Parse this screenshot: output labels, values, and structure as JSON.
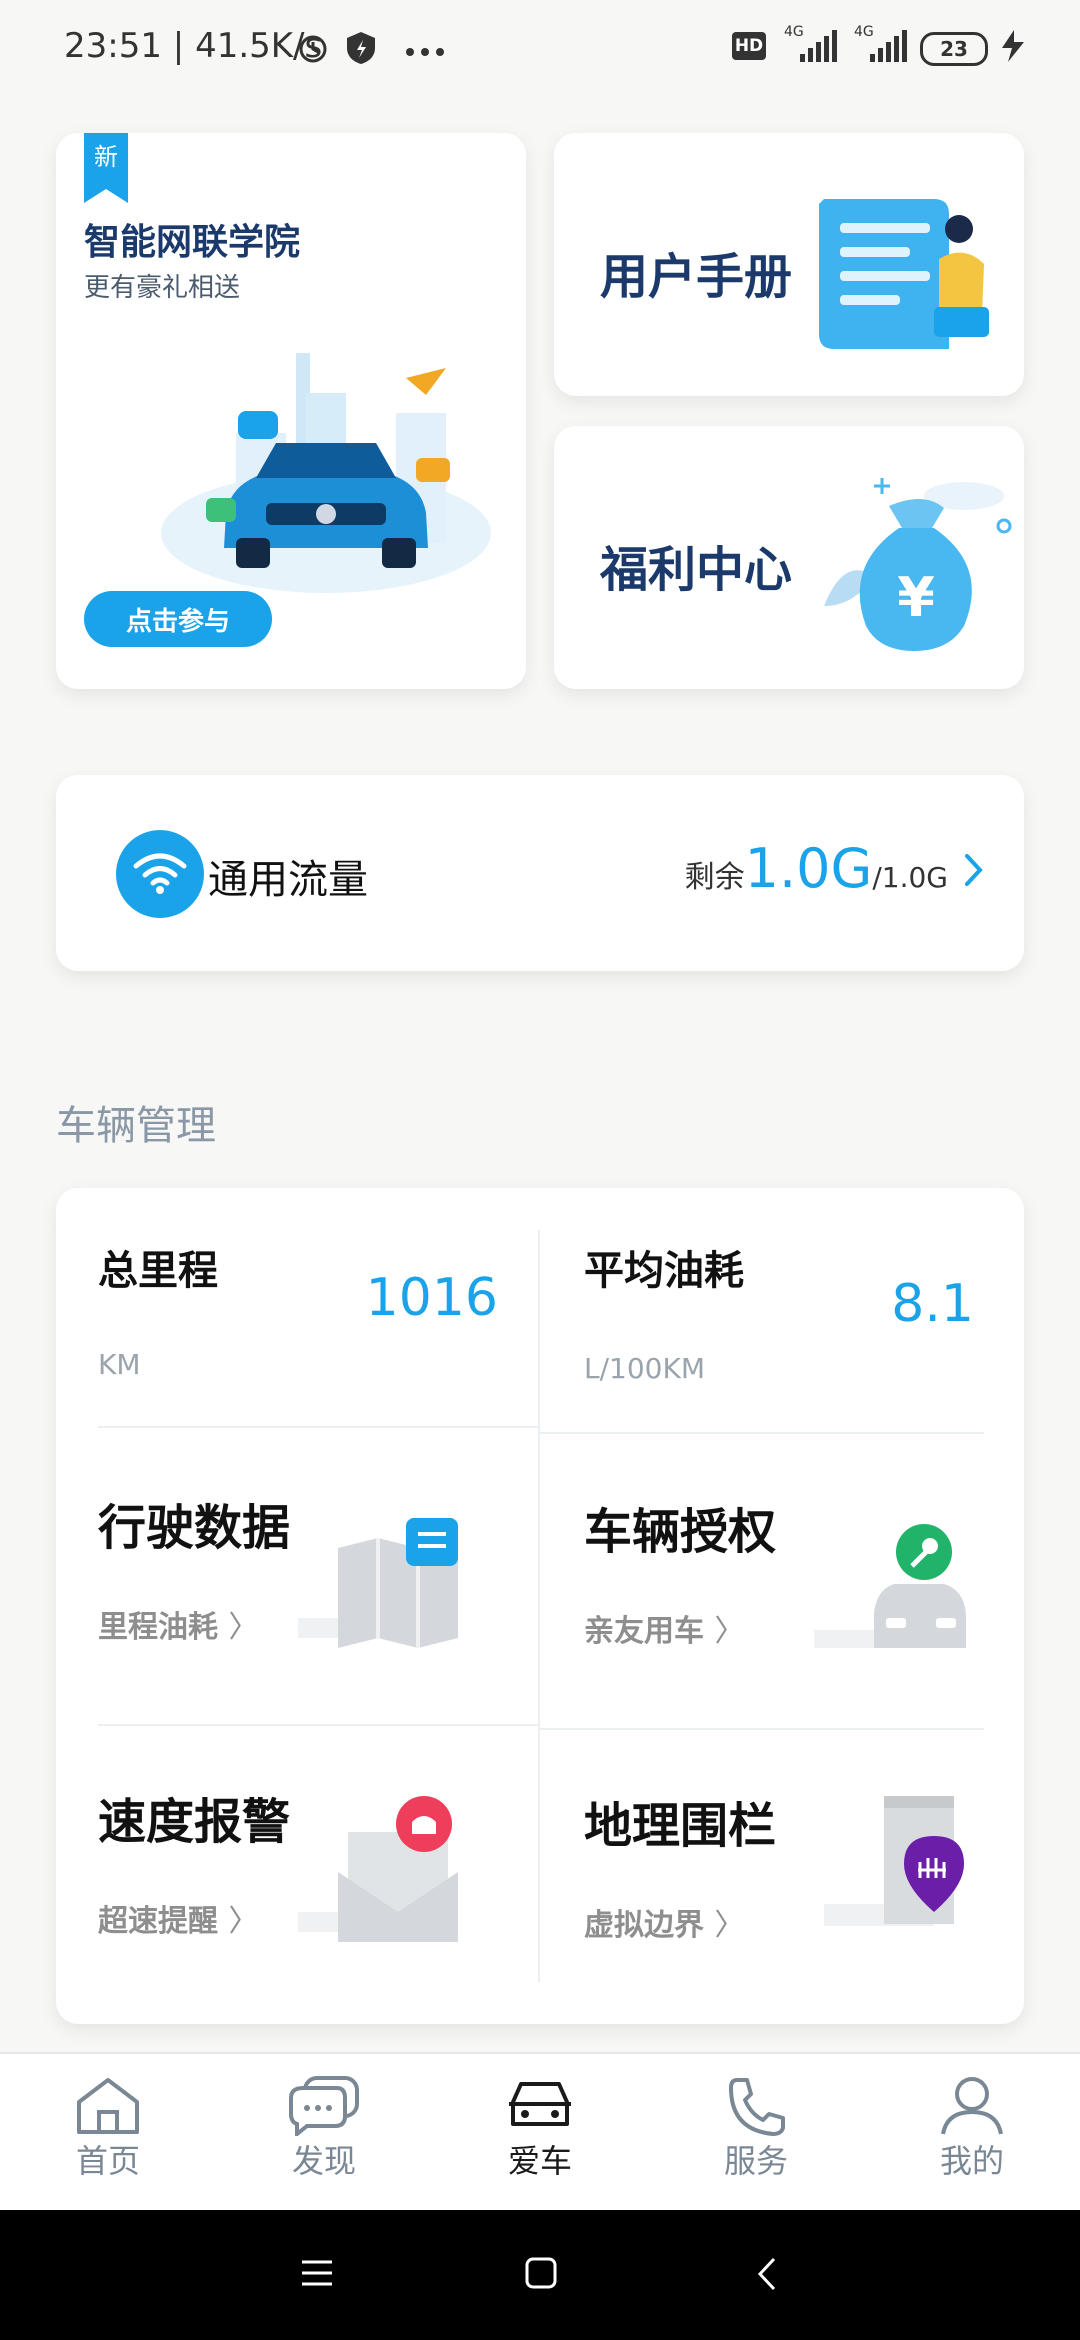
{
  "status_bar": {
    "time": "23:51",
    "network_speed": "41.5K/s",
    "battery": "23",
    "icons": [
      "alarm-icon",
      "shield-icon",
      "more-icon",
      "hd-icon",
      "signal-4g-icon",
      "signal-4g-icon",
      "battery-icon",
      "charging-icon"
    ],
    "hd": "HD",
    "net1": "4G",
    "net2": "4G"
  },
  "promo": {
    "badge": "新",
    "title": "智能网联学院",
    "subtitle": "更有豪礼相送",
    "button": "点击参与"
  },
  "manual": {
    "title": "用户手册"
  },
  "welfare": {
    "title": "福利中心"
  },
  "data_plan": {
    "label": "通用流量",
    "remain_prefix": "剩余",
    "remain_value": "1.0G",
    "total": "/1.0G"
  },
  "vehicle": {
    "section_title": "车辆管理",
    "mileage": {
      "label": "总里程",
      "value": "1016",
      "unit": "KM"
    },
    "fuel": {
      "label": "平均油耗",
      "value": "8.1",
      "unit": "L/100KM"
    },
    "tiles": [
      {
        "title": "行驶数据",
        "sub": "里程油耗"
      },
      {
        "title": "车辆授权",
        "sub": "亲友用车"
      },
      {
        "title": "速度报警",
        "sub": "超速提醒"
      },
      {
        "title": "地理围栏",
        "sub": "虚拟边界"
      }
    ]
  },
  "nav": {
    "items": [
      {
        "label": "首页",
        "icon": "home-icon"
      },
      {
        "label": "发现",
        "icon": "chat-icon"
      },
      {
        "label": "爱车",
        "icon": "car-icon"
      },
      {
        "label": "服务",
        "icon": "phone-icon"
      },
      {
        "label": "我的",
        "icon": "user-icon"
      }
    ],
    "active": "爱车"
  },
  "colors": {
    "accent": "#1aa3e8",
    "title_dark": "#1b3a6b",
    "active_nav": "#1a1a1a"
  }
}
